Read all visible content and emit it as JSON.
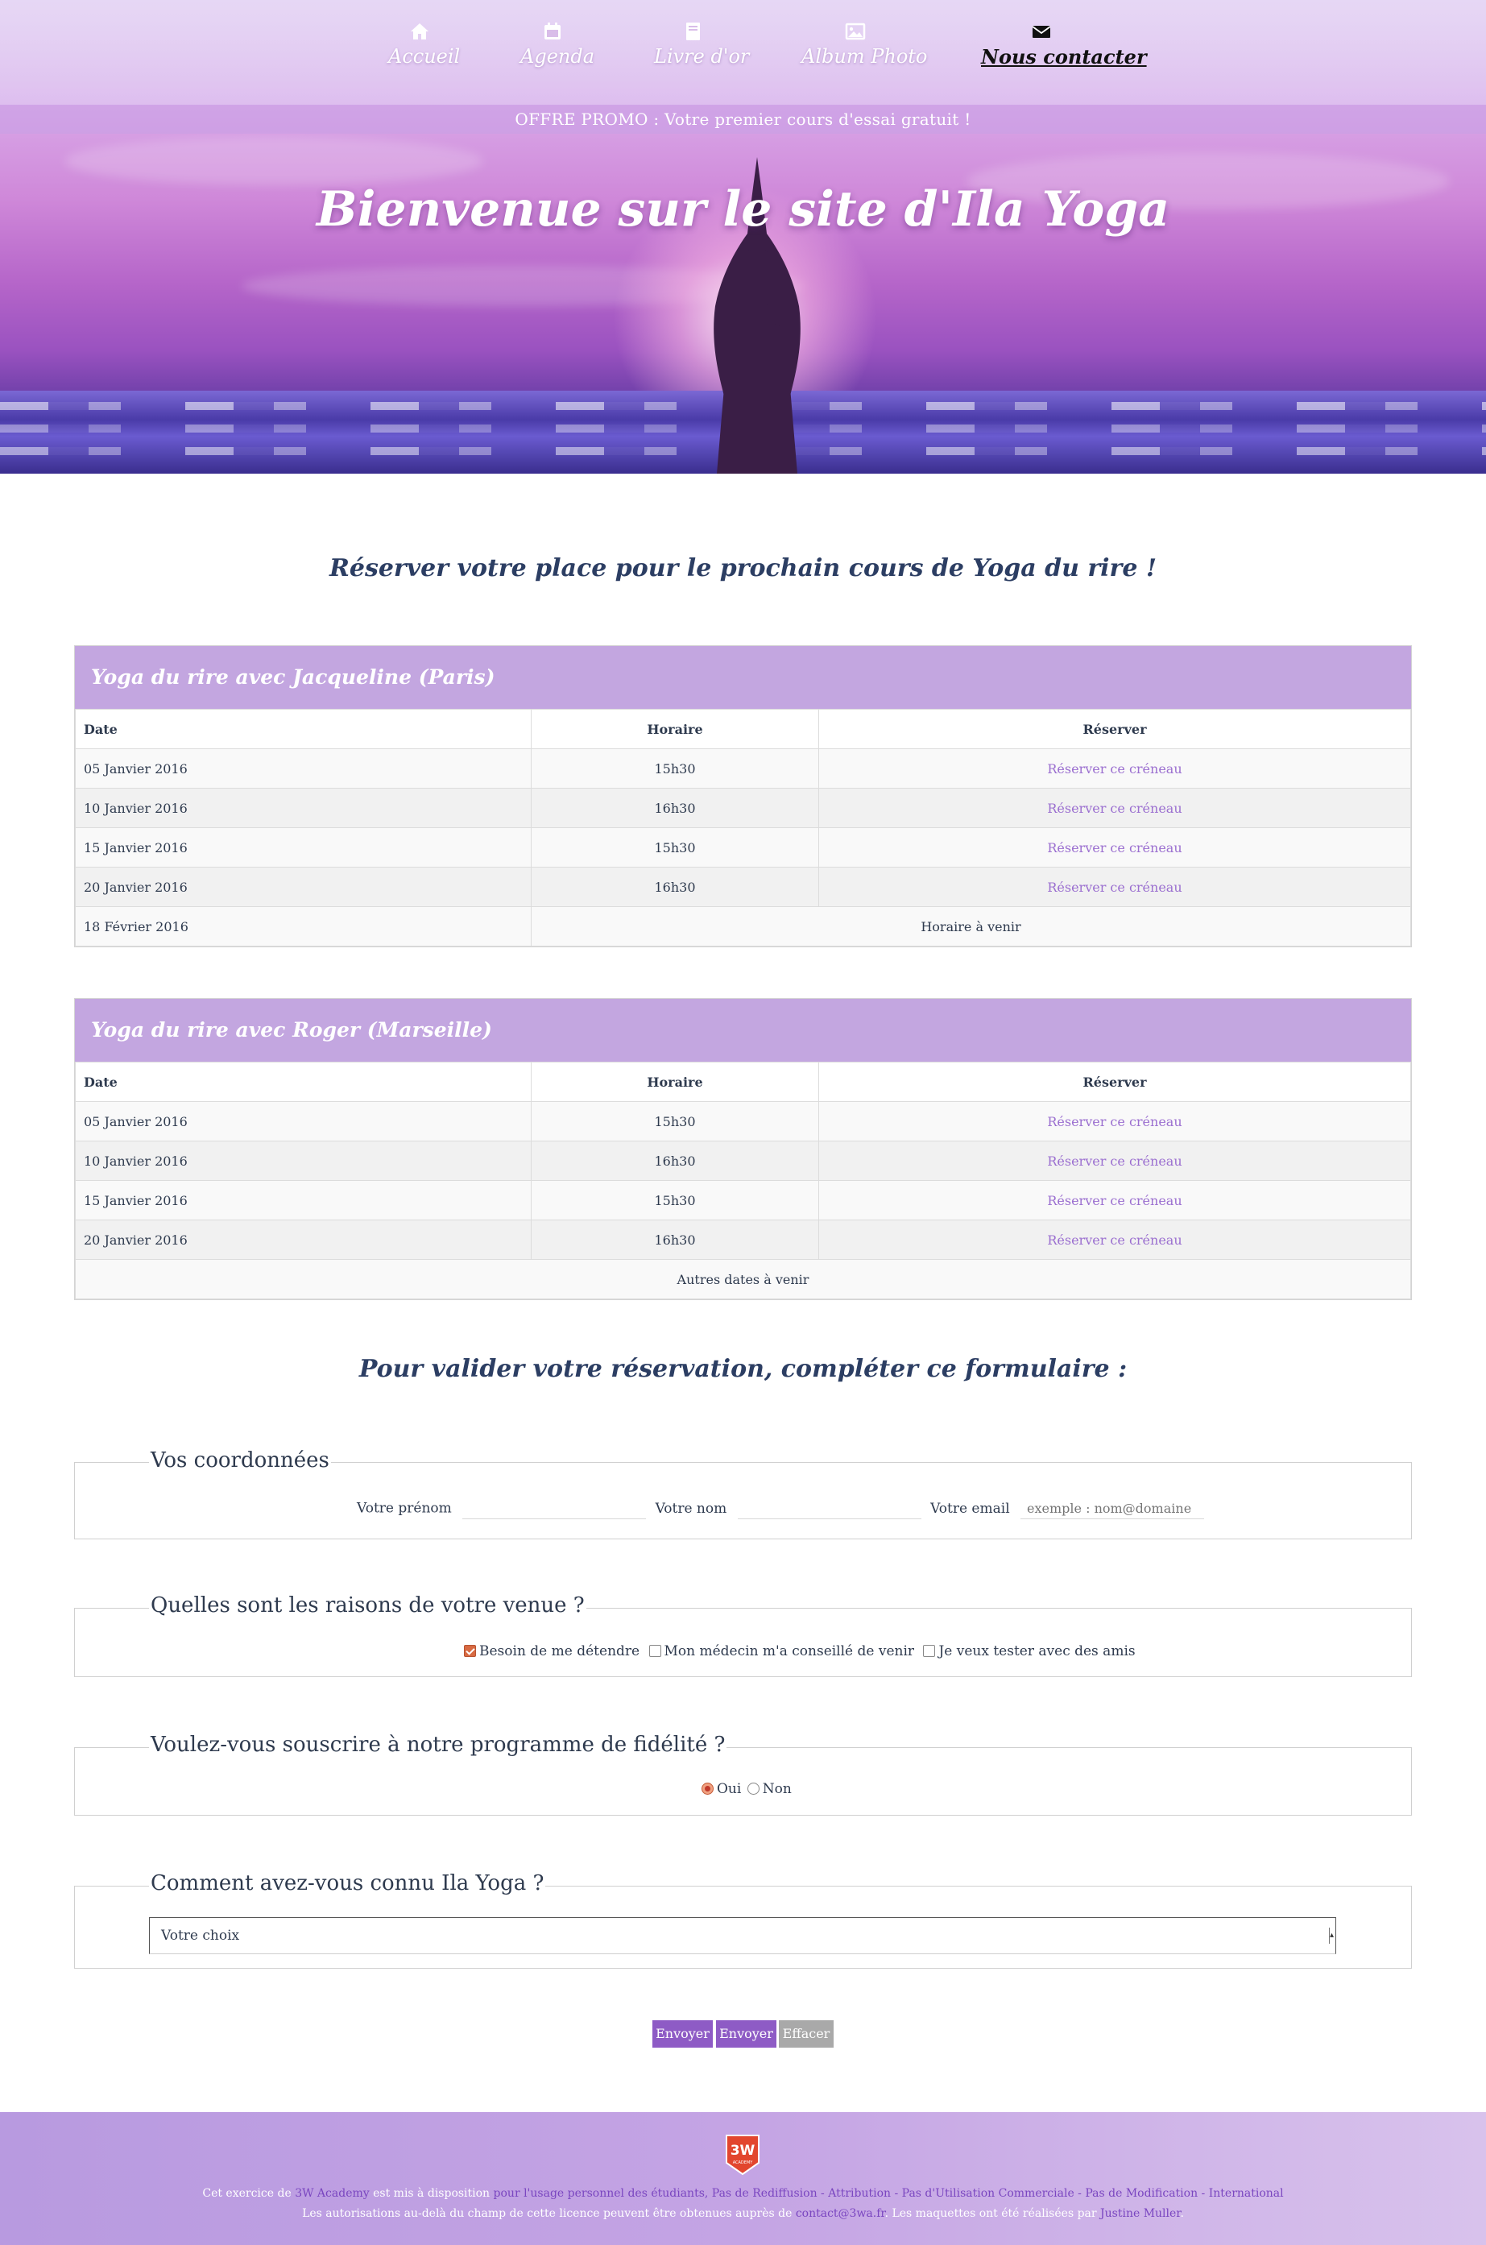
{
  "nav": {
    "items": [
      {
        "label": "Accueil",
        "icon": "home-icon"
      },
      {
        "label": "Agenda",
        "icon": "calendar-icon"
      },
      {
        "label": "Livre d'or",
        "icon": "book-icon"
      },
      {
        "label": "Album Photo",
        "icon": "image-icon"
      },
      {
        "label": "Nous contacter",
        "icon": "envelope-icon",
        "active": true
      }
    ]
  },
  "promo": "OFFRE PROMO : Votre premier cours d'essai gratuit !",
  "hero_title": "Bienvenue sur le site d'Ila Yoga",
  "booking_title": "Réserver votre place pour le prochain cours de Yoga du rire !",
  "schedules": [
    {
      "title": "Yoga du rire avec Jacqueline (Paris)",
      "headers": [
        "Date",
        "Horaire",
        "Réserver"
      ],
      "rows": [
        {
          "date": "05 Janvier 2016",
          "time": "15h30",
          "book": "Réserver ce créneau"
        },
        {
          "date": "10 Janvier 2016",
          "time": "16h30",
          "book": "Réserver ce créneau"
        },
        {
          "date": "15 Janvier 2016",
          "time": "15h30",
          "book": "Réserver ce créneau"
        },
        {
          "date": "20 Janvier 2016",
          "time": "16h30",
          "book": "Réserver ce créneau"
        }
      ],
      "last_row": {
        "date": "18 Février 2016",
        "note": "Horaire à venir"
      }
    },
    {
      "title": "Yoga du rire avec Roger (Marseille)",
      "headers": [
        "Date",
        "Horaire",
        "Réserver"
      ],
      "rows": [
        {
          "date": "05 Janvier 2016",
          "time": "15h30",
          "book": "Réserver ce créneau"
        },
        {
          "date": "10 Janvier 2016",
          "time": "16h30",
          "book": "Réserver ce créneau"
        },
        {
          "date": "15 Janvier 2016",
          "time": "15h30",
          "book": "Réserver ce créneau"
        },
        {
          "date": "20 Janvier 2016",
          "time": "16h30",
          "book": "Réserver ce créneau"
        }
      ],
      "last_row": {
        "note": "Autres dates à venir"
      }
    }
  ],
  "form_title": "Pour valider votre réservation, compléter ce formulaire :",
  "form": {
    "contact": {
      "legend": "Vos coordonnées",
      "firstname_label": "Votre prénom",
      "lastname_label": "Votre nom",
      "email_label": "Votre email",
      "email_placeholder": "exemple : nom@domaine"
    },
    "reasons": {
      "legend": "Quelles sont les raisons de votre venue ?",
      "options": [
        {
          "label": "Besoin de me détendre",
          "checked": true
        },
        {
          "label": "Mon médecin m'a conseillé de venir",
          "checked": false
        },
        {
          "label": "Je veux tester avec des amis",
          "checked": false
        }
      ]
    },
    "loyalty": {
      "legend": "Voulez-vous souscrire à notre programme de fidélité ?",
      "options": [
        {
          "label": "Oui",
          "selected": true
        },
        {
          "label": "Non",
          "selected": false
        }
      ]
    },
    "source": {
      "legend": "Comment avez-vous connu Ila Yoga ?",
      "selected": "Votre choix"
    },
    "buttons": [
      "Envoyer",
      "Envoyer",
      "Effacer"
    ]
  },
  "footer": {
    "badge_text": "3W",
    "badge_sub": "ACADEMY",
    "line1": {
      "a": "Cet exercice de ",
      "link1": "3W Academy",
      "b": " est mis à disposition ",
      "link2": "pour l'usage personnel des étudiants, Pas de Rediffusion - Attribution - Pas d'Utilisation Commerciale - Pas de Modification - International"
    },
    "line2": {
      "a": "Les autorisations au-delà du champ de cette licence peuvent être obtenues auprès de ",
      "link1": "contact@3wa.fr",
      "b": ". Les maquettes ont été réalisées par ",
      "link2": "Justine Muller",
      "c": "."
    }
  },
  "colors": {
    "panel_header": "#c3a6e0",
    "link": "#9b6fd0",
    "button": "#8e5bc5",
    "button_reset": "#a9a9a9",
    "heading": "#2c3e63"
  }
}
